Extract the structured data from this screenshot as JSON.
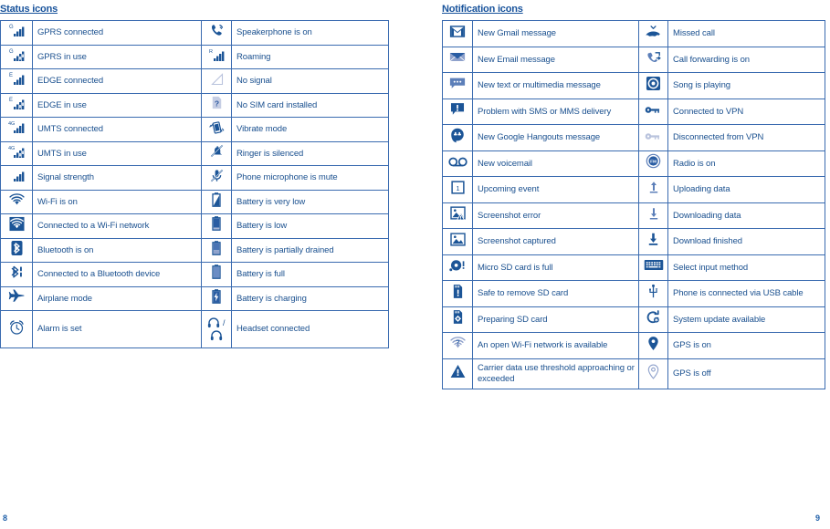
{
  "colors": {
    "primary_blue": "#1a508f",
    "border_blue": "#3a6bb0",
    "outer_border": "#1f4f93",
    "heading_blue": "#17529b",
    "icon_blue": "#1c5597",
    "icon_light": "#b9c3dd"
  },
  "page_numbers": {
    "left": "8",
    "right": "9"
  },
  "status": {
    "heading": "Status icons",
    "rows": [
      {
        "icon_a": "gprs-connected-icon",
        "label_a": "GPRS connected",
        "icon_b": "speakerphone-icon",
        "label_b": "Speakerphone is on"
      },
      {
        "icon_a": "gprs-in-use-icon",
        "label_a": "GPRS in use",
        "icon_b": "roaming-icon",
        "label_b": "Roaming"
      },
      {
        "icon_a": "edge-connected-icon",
        "label_a": "EDGE connected",
        "icon_b": "no-signal-icon",
        "label_b": "No signal"
      },
      {
        "icon_a": "edge-in-use-icon",
        "label_a": "EDGE in use",
        "icon_b": "no-sim-card-icon",
        "label_b": "No SIM card installed"
      },
      {
        "icon_a": "umts-connected-icon",
        "label_a": "UMTS connected",
        "icon_b": "vibrate-mode-icon",
        "label_b": "Vibrate mode"
      },
      {
        "icon_a": "umts-in-use-icon",
        "label_a": "UMTS in use",
        "icon_b": "ringer-silenced-icon",
        "label_b": "Ringer is silenced"
      },
      {
        "icon_a": "signal-strength-icon",
        "label_a": "Signal strength",
        "icon_b": "microphone-mute-icon",
        "label_b": "Phone microphone is mute"
      },
      {
        "icon_a": "wifi-on-icon",
        "label_a": "Wi-Fi is on",
        "icon_b": "battery-very-low-icon",
        "label_b": "Battery is very low"
      },
      {
        "icon_a": "wifi-connected-icon",
        "label_a": "Connected to a Wi-Fi network",
        "icon_b": "battery-low-icon",
        "label_b": "Battery is low"
      },
      {
        "icon_a": "bluetooth-on-icon",
        "label_a": "Bluetooth is on",
        "icon_b": "battery-partial-icon",
        "label_b": "Battery is partially drained"
      },
      {
        "icon_a": "bluetooth-connected-icon",
        "label_a": "Connected to a Bluetooth device",
        "icon_b": "battery-full-icon",
        "label_b": "Battery is full"
      },
      {
        "icon_a": "airplane-mode-icon",
        "label_a": "Airplane mode",
        "icon_b": "battery-charging-icon",
        "label_b": "Battery is charging"
      },
      {
        "icon_a": "alarm-set-icon",
        "label_a": "Alarm is set",
        "icon_b": "headset-connected-icon",
        "label_b": "Headset connected"
      }
    ]
  },
  "notification": {
    "heading": "Notification icons",
    "rows": [
      {
        "icon_a": "new-gmail-icon",
        "label_a": "New Gmail message",
        "icon_b": "missed-call-icon",
        "label_b": "Missed call"
      },
      {
        "icon_a": "new-email-icon",
        "label_a": "New Email message",
        "icon_b": "call-forwarding-icon",
        "label_b": "Call forwarding is on"
      },
      {
        "icon_a": "new-sms-mms-icon",
        "label_a": "New text or multimedia message",
        "icon_b": "song-playing-icon",
        "label_b": "Song is playing"
      },
      {
        "icon_a": "sms-problem-icon",
        "label_a": "Problem with SMS or MMS delivery",
        "icon_b": "vpn-connected-icon",
        "label_b": "Connected to VPN"
      },
      {
        "icon_a": "hangouts-icon",
        "label_a": "New Google Hangouts message",
        "icon_b": "vpn-disconnected-icon",
        "label_b": "Disconnected from VPN"
      },
      {
        "icon_a": "voicemail-icon",
        "label_a": "New voicemail",
        "icon_b": "radio-on-icon",
        "label_b": "Radio is on"
      },
      {
        "icon_a": "upcoming-event-icon",
        "label_a": "Upcoming event",
        "icon_b": "uploading-data-icon",
        "label_b": "Uploading data"
      },
      {
        "icon_a": "screenshot-error-icon",
        "label_a": "Screenshot error",
        "icon_b": "downloading-data-icon",
        "label_b": "Downloading data"
      },
      {
        "icon_a": "screenshot-captured-icon",
        "label_a": "Screenshot captured",
        "icon_b": "download-finished-icon",
        "label_b": "Download finished"
      },
      {
        "icon_a": "sd-card-full-icon",
        "label_a": "Micro SD card is full",
        "icon_b": "select-input-method-icon",
        "label_b": "Select input method"
      },
      {
        "icon_a": "sd-card-safe-remove-icon",
        "label_a": "Safe to remove SD card",
        "icon_b": "usb-connected-icon",
        "label_b": "Phone is connected via USB cable"
      },
      {
        "icon_a": "sd-card-preparing-icon",
        "label_a": "Preparing SD card",
        "icon_b": "system-update-icon",
        "label_b": "System update available"
      },
      {
        "icon_a": "open-wifi-icon",
        "label_a": "An open Wi-Fi network is available",
        "icon_b": "gps-on-icon",
        "label_b": "GPS is on"
      },
      {
        "icon_a": "carrier-data-warning-icon",
        "label_a": "Carrier data use threshold approaching or exceeded",
        "icon_b": "gps-off-icon",
        "label_b": "GPS is off"
      }
    ]
  }
}
